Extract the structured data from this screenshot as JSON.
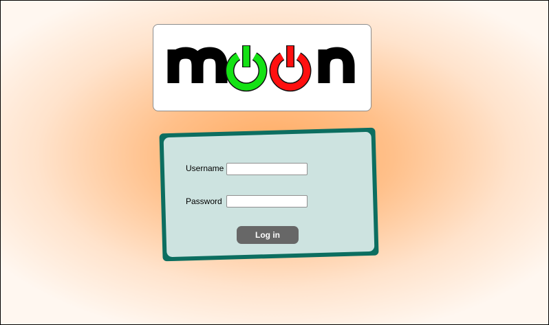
{
  "logo": {
    "text": "moon",
    "icon_left": "power-icon",
    "icon_right": "power-icon",
    "colors": {
      "letters": "#000000",
      "power_left": "#15e215",
      "power_right": "#ff1010"
    }
  },
  "login_form": {
    "username_label": "Username",
    "username_value": "",
    "password_label": "Password",
    "password_value": "",
    "submit_label": "Log in"
  },
  "colors": {
    "background_center": "#ffa95e",
    "card_border": "#0c6e60",
    "card_fill": "#cde3e0",
    "button": "#676767"
  }
}
